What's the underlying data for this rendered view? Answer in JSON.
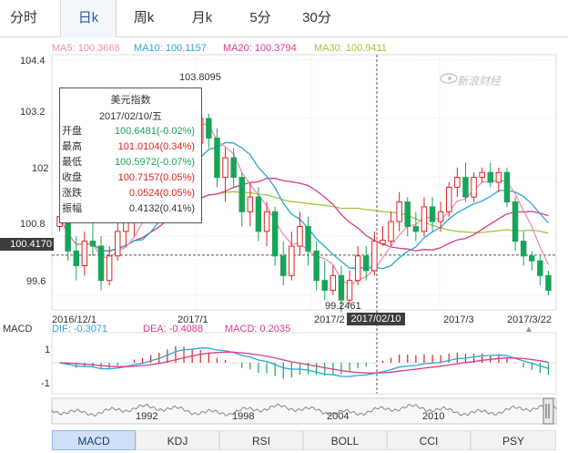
{
  "tabs": [
    {
      "label": "分时"
    },
    {
      "label": "日k"
    },
    {
      "label": "周k"
    },
    {
      "label": "月k"
    },
    {
      "label": "5分"
    },
    {
      "label": "30分"
    }
  ],
  "active_tab": "日k",
  "ma_legend": {
    "ma5": "MA5: 100.3668",
    "ma10": "MA10: 100.1157",
    "ma20": "MA20: 100.3794",
    "ma30": "MA30: 100.9411"
  },
  "colors": {
    "ma5": "#f08cb4",
    "ma10": "#2aa6d6",
    "ma20": "#d63c87",
    "ma30": "#a6c23c",
    "up": "#e02020",
    "down": "#18a55a",
    "dif": "#2aa6d6",
    "dea": "#d63c87"
  },
  "watermark": "新浪财经",
  "y_ticks": [
    "104.4",
    "103.2",
    "102",
    "100.8",
    "99.6"
  ],
  "x_labels": [
    "2016/12/1",
    "2017/1",
    "2017/2",
    "2017/3",
    "2017/3/22"
  ],
  "high_label": "103.8095",
  "low_label": "99.2461",
  "crosshair": {
    "price": "100.4170",
    "date": "2017/02/10"
  },
  "tooltip": {
    "title": "美元指数",
    "date": "2017/02/10/五",
    "rows": [
      {
        "label": "开盘",
        "value": "100.6481(-0.02%)",
        "color": "#18a55a"
      },
      {
        "label": "最高",
        "value": "101.0104(0.34%)",
        "color": "#e02020"
      },
      {
        "label": "最低",
        "value": "100.5972(-0.07%)",
        "color": "#18a55a"
      },
      {
        "label": "收盘",
        "value": "100.7157(0.05%)",
        "color": "#e02020"
      },
      {
        "label": "涨跌",
        "value": "0.0524(0.05%)",
        "color": "#e02020"
      },
      {
        "label": "振幅",
        "value": "0.4132(0.41%)",
        "color": "#333333"
      }
    ]
  },
  "macd": {
    "label": "MACD",
    "dif": "DIF: -0.3071",
    "dea": "DEA: -0.4088",
    "macd": "MACD: 0.2035",
    "y_ticks": [
      "1",
      "-1"
    ]
  },
  "navigator_years": [
    "1992",
    "1998",
    "2004",
    "2010"
  ],
  "indicator_tabs": [
    {
      "label": "MACD"
    },
    {
      "label": "KDJ"
    },
    {
      "label": "RSI"
    },
    {
      "label": "BOLL"
    },
    {
      "label": "CCI"
    },
    {
      "label": "PSY"
    }
  ],
  "active_indicator": "MACD",
  "chart_data": {
    "type": "candlestick",
    "title": "美元指数",
    "y_range": [
      99.3,
      104.5
    ],
    "series": [
      {
        "name": "MA5",
        "value_last": 100.3668
      },
      {
        "name": "MA10",
        "value_last": 100.1157
      },
      {
        "name": "MA20",
        "value_last": 100.3794
      },
      {
        "name": "MA30",
        "value_last": 100.9411
      }
    ],
    "candles": [
      [
        101.0,
        101.5,
        100.9,
        101.2
      ],
      [
        101.1,
        101.3,
        100.3,
        100.5
      ],
      [
        100.5,
        100.8,
        99.9,
        100.2
      ],
      [
        100.2,
        100.9,
        100.0,
        100.7
      ],
      [
        100.7,
        101.1,
        100.4,
        100.6
      ],
      [
        100.6,
        100.8,
        99.7,
        99.9
      ],
      [
        99.9,
        100.6,
        99.8,
        100.4
      ],
      [
        100.4,
        101.1,
        100.3,
        100.9
      ],
      [
        100.9,
        101.3,
        100.6,
        101.1
      ],
      [
        101.1,
        101.7,
        100.8,
        101.6
      ],
      [
        101.6,
        101.8,
        101.2,
        101.4
      ],
      [
        101.4,
        102.3,
        101.3,
        102.1
      ],
      [
        102.1,
        102.5,
        101.8,
        102.3
      ],
      [
        102.3,
        103.2,
        102.2,
        103.0
      ],
      [
        103.0,
        103.6,
        102.8,
        103.5
      ],
      [
        103.5,
        103.81,
        102.9,
        103.1
      ],
      [
        103.1,
        103.3,
        102.5,
        102.7
      ],
      [
        102.7,
        103.4,
        102.6,
        103.2
      ],
      [
        103.2,
        103.3,
        102.6,
        102.8
      ],
      [
        102.8,
        103.0,
        101.8,
        102.0
      ],
      [
        102.0,
        102.6,
        101.5,
        102.4
      ],
      [
        102.4,
        102.6,
        101.8,
        102.0
      ],
      [
        102.0,
        102.1,
        101.0,
        101.3
      ],
      [
        101.3,
        101.9,
        101.0,
        101.6
      ],
      [
        101.6,
        101.8,
        100.7,
        100.9
      ],
      [
        100.9,
        101.5,
        100.6,
        101.3
      ],
      [
        101.3,
        101.4,
        100.2,
        100.4
      ],
      [
        100.4,
        100.7,
        99.8,
        100.0
      ],
      [
        100.0,
        100.9,
        99.9,
        100.6
      ],
      [
        100.6,
        101.3,
        100.4,
        101.0
      ],
      [
        101.0,
        101.2,
        100.2,
        100.5
      ],
      [
        100.5,
        100.7,
        99.7,
        99.9
      ],
      [
        99.9,
        100.3,
        99.5,
        99.7
      ],
      [
        99.7,
        100.2,
        99.6,
        100.0
      ],
      [
        100.0,
        100.2,
        99.25,
        99.5
      ],
      [
        99.5,
        100.1,
        99.4,
        99.9
      ],
      [
        99.9,
        100.6,
        99.8,
        100.4
      ],
      [
        100.4,
        100.6,
        99.9,
        100.1
      ],
      [
        100.1,
        100.9,
        100.0,
        100.7
      ],
      [
        100.65,
        101.01,
        100.6,
        100.72
      ],
      [
        100.7,
        101.3,
        100.6,
        101.1
      ],
      [
        101.1,
        101.7,
        100.9,
        101.5
      ],
      [
        101.5,
        101.6,
        100.8,
        101.0
      ],
      [
        101.0,
        101.3,
        100.7,
        100.9
      ],
      [
        100.9,
        101.6,
        100.8,
        101.4
      ],
      [
        101.4,
        101.6,
        100.9,
        101.1
      ],
      [
        101.1,
        101.5,
        100.9,
        101.3
      ],
      [
        101.3,
        101.9,
        101.2,
        101.8
      ],
      [
        101.8,
        102.2,
        101.6,
        102.0
      ],
      [
        102.0,
        102.3,
        101.5,
        101.6
      ],
      [
        101.6,
        102.1,
        101.5,
        102.0
      ],
      [
        102.0,
        102.2,
        101.9,
        102.1
      ],
      [
        102.1,
        102.3,
        101.8,
        101.9
      ],
      [
        101.9,
        102.2,
        101.7,
        102.1
      ],
      [
        102.1,
        102.2,
        101.4,
        101.5
      ],
      [
        101.5,
        101.6,
        100.5,
        100.7
      ],
      [
        100.7,
        100.9,
        100.2,
        100.4
      ],
      [
        100.4,
        100.5,
        100.1,
        100.3
      ],
      [
        100.3,
        100.4,
        99.8,
        100.0
      ],
      [
        100.0,
        100.1,
        99.6,
        99.7
      ]
    ]
  }
}
